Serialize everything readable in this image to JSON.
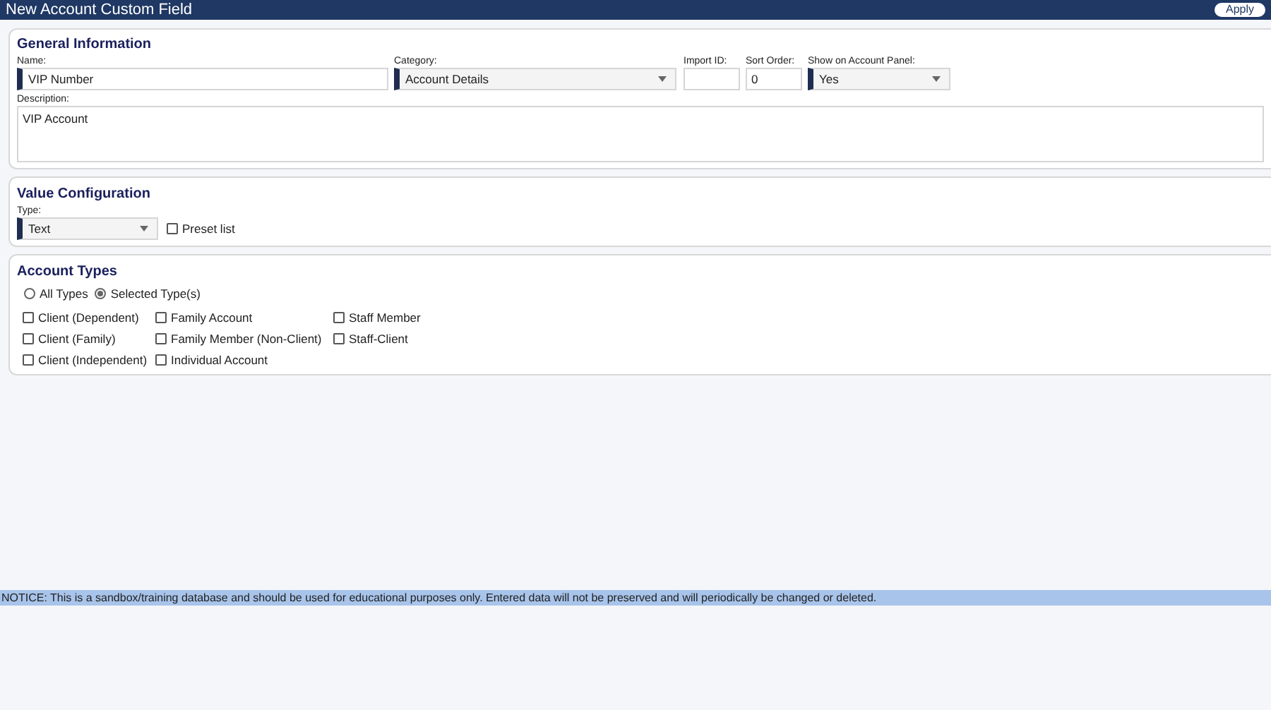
{
  "window": {
    "title": "New Account Custom Field",
    "buttons": [
      "Apply"
    ]
  },
  "general": {
    "title": "General Information",
    "name": {
      "label": "Name:",
      "value": "VIP Number"
    },
    "category": {
      "label": "Category:",
      "value": "Account Details"
    },
    "import_id": {
      "label": "Import ID:"
    },
    "sort_order": {
      "label": "Sort Order:",
      "value": "0"
    },
    "show_on_panel": {
      "label": "Show on Account Panel:",
      "value": "Yes"
    },
    "description": {
      "label": "Description:",
      "value": "VIP Account"
    }
  },
  "value_config": {
    "title": "Value Configuration",
    "type": {
      "label": "Type:",
      "value": "Text"
    },
    "preset_list": {
      "label": "Preset list",
      "checked": false
    }
  },
  "account_types": {
    "title": "Account Types",
    "scope": [
      {
        "label": "All Types",
        "selected": false
      },
      {
        "label": "Selected Type(s)",
        "selected": true
      }
    ],
    "types": [
      {
        "label": "Client (Dependent)",
        "checked": false
      },
      {
        "label": "Family Account",
        "checked": false
      },
      {
        "label": "Staff Member",
        "checked": false
      },
      {
        "label": "Client (Family)",
        "checked": false
      },
      {
        "label": "Family Member (Non-Client)",
        "checked": false
      },
      {
        "label": "Staff-Client",
        "checked": false
      },
      {
        "label": "Client (Independent)",
        "checked": false
      },
      {
        "label": "Individual Account",
        "checked": false
      }
    ]
  },
  "notice": "NOTICE: This is a sandbox/training database and should be used for educational purposes only. Entered data will not be preserved and will periodically be changed or deleted."
}
